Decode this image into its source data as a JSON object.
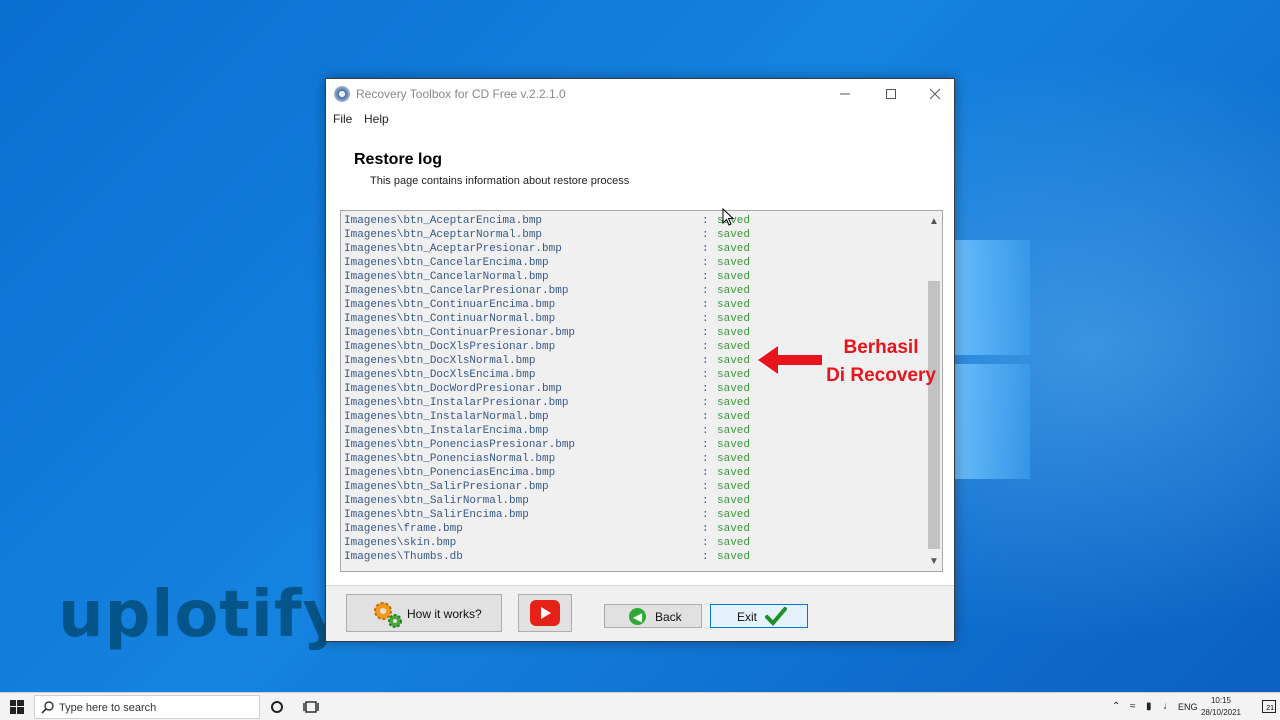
{
  "watermark": "uplotify",
  "window": {
    "title": "Recovery Toolbox for CD Free v.2.2.1.0",
    "menu": [
      "File",
      "Help"
    ]
  },
  "header": {
    "title": "Restore log",
    "subtitle": "This page contains information about restore process"
  },
  "log": {
    "separator": ":",
    "rows": [
      {
        "file": "Imagenes\\btn_AceptarEncima.bmp",
        "status": "saved"
      },
      {
        "file": "Imagenes\\btn_AceptarNormal.bmp",
        "status": "saved"
      },
      {
        "file": "Imagenes\\btn_AceptarPresionar.bmp",
        "status": "saved"
      },
      {
        "file": "Imagenes\\btn_CancelarEncima.bmp",
        "status": "saved"
      },
      {
        "file": "Imagenes\\btn_CancelarNormal.bmp",
        "status": "saved"
      },
      {
        "file": "Imagenes\\btn_CancelarPresionar.bmp",
        "status": "saved"
      },
      {
        "file": "Imagenes\\btn_ContinuarEncima.bmp",
        "status": "saved"
      },
      {
        "file": "Imagenes\\btn_ContinuarNormal.bmp",
        "status": "saved"
      },
      {
        "file": "Imagenes\\btn_ContinuarPresionar.bmp",
        "status": "saved"
      },
      {
        "file": "Imagenes\\btn_DocXlsPresionar.bmp",
        "status": "saved"
      },
      {
        "file": "Imagenes\\btn_DocXlsNormal.bmp",
        "status": "saved"
      },
      {
        "file": "Imagenes\\btn_DocXlsEncima.bmp",
        "status": "saved"
      },
      {
        "file": "Imagenes\\btn_DocWordPresionar.bmp",
        "status": "saved"
      },
      {
        "file": "Imagenes\\btn_InstalarPresionar.bmp",
        "status": "saved"
      },
      {
        "file": "Imagenes\\btn_InstalarNormal.bmp",
        "status": "saved"
      },
      {
        "file": "Imagenes\\btn_InstalarEncima.bmp",
        "status": "saved"
      },
      {
        "file": "Imagenes\\btn_PonenciasPresionar.bmp",
        "status": "saved"
      },
      {
        "file": "Imagenes\\btn_PonenciasNormal.bmp",
        "status": "saved"
      },
      {
        "file": "Imagenes\\btn_PonenciasEncima.bmp",
        "status": "saved"
      },
      {
        "file": "Imagenes\\btn_SalirPresionar.bmp",
        "status": "saved"
      },
      {
        "file": "Imagenes\\btn_SalirNormal.bmp",
        "status": "saved"
      },
      {
        "file": "Imagenes\\btn_SalirEncima.bmp",
        "status": "saved"
      },
      {
        "file": "Imagenes\\frame.bmp",
        "status": "saved"
      },
      {
        "file": "Imagenes\\skin.bmp",
        "status": "saved"
      },
      {
        "file": "Imagenes\\Thumbs.db",
        "status": "saved"
      }
    ]
  },
  "annotation": {
    "line1": "Berhasil",
    "line2": "Di Recovery",
    "color": "#e8141c"
  },
  "buttons": {
    "how": "How it works?",
    "back": "Back",
    "exit": "Exit"
  },
  "taskbar": {
    "search_placeholder": "Type here to search",
    "language": "ENG",
    "time": "10:15",
    "date": "28/10/2021",
    "notifications": "21"
  },
  "colors": {
    "log_name": "#385a86",
    "log_status": "#3a9a3a",
    "desktop": "#1583e0"
  }
}
